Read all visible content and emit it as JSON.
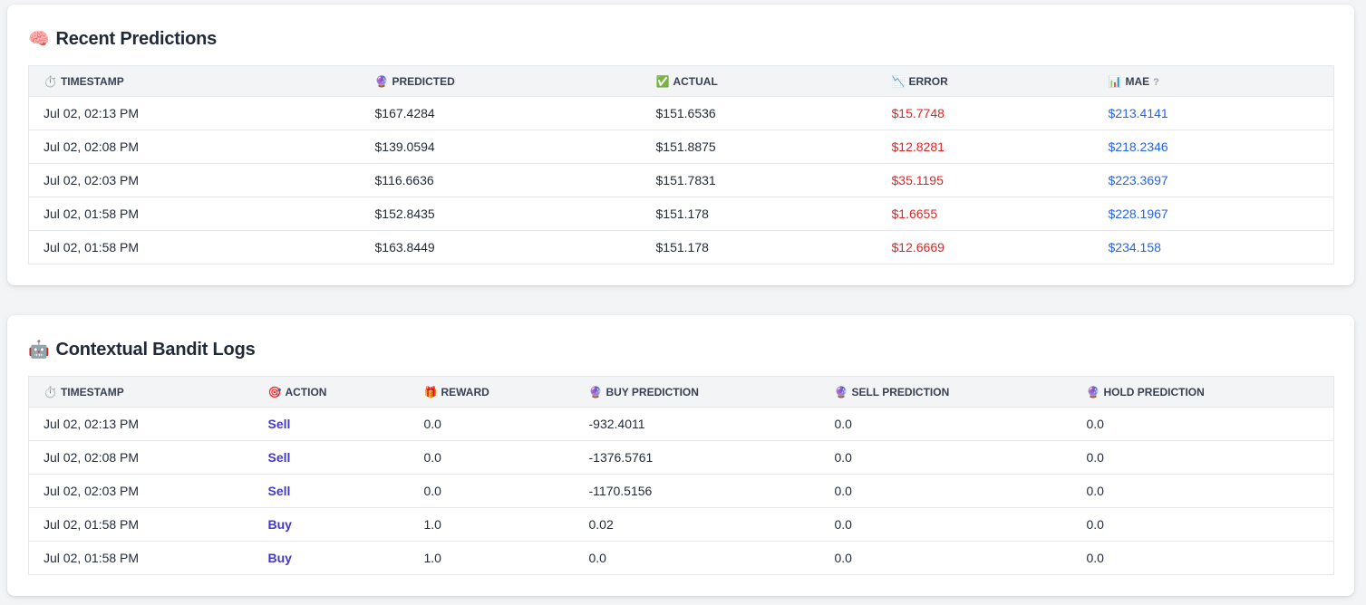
{
  "predictions": {
    "title": "Recent Predictions",
    "title_icon": "🧠",
    "headers": {
      "timestamp": {
        "icon": "⏱️",
        "label": "TIMESTAMP"
      },
      "predicted": {
        "icon": "🔮",
        "label": "PREDICTED"
      },
      "actual": {
        "icon": "✅",
        "label": "ACTUAL"
      },
      "error": {
        "icon": "📉",
        "label": "ERROR"
      },
      "mae": {
        "icon": "📊",
        "label": "MAE",
        "help": "?"
      }
    },
    "rows": [
      {
        "timestamp": "Jul 02, 02:13 PM",
        "predicted": "$167.4284",
        "actual": "$151.6536",
        "error": "$15.7748",
        "mae": "$213.4141"
      },
      {
        "timestamp": "Jul 02, 02:08 PM",
        "predicted": "$139.0594",
        "actual": "$151.8875",
        "error": "$12.8281",
        "mae": "$218.2346"
      },
      {
        "timestamp": "Jul 02, 02:03 PM",
        "predicted": "$116.6636",
        "actual": "$151.7831",
        "error": "$35.1195",
        "mae": "$223.3697"
      },
      {
        "timestamp": "Jul 02, 01:58 PM",
        "predicted": "$152.8435",
        "actual": "$151.178",
        "error": "$1.6655",
        "mae": "$228.1967"
      },
      {
        "timestamp": "Jul 02, 01:58 PM",
        "predicted": "$163.8449",
        "actual": "$151.178",
        "error": "$12.6669",
        "mae": "$234.158"
      }
    ]
  },
  "bandit": {
    "title": "Contextual Bandit Logs",
    "title_icon": "🤖",
    "headers": {
      "timestamp": {
        "icon": "⏱️",
        "label": "TIMESTAMP"
      },
      "action": {
        "icon": "🎯",
        "label": "ACTION"
      },
      "reward": {
        "icon": "🎁",
        "label": "REWARD"
      },
      "buy_prediction": {
        "icon": "🔮",
        "label": "BUY PREDICTION"
      },
      "sell_prediction": {
        "icon": "🔮",
        "label": "SELL PREDICTION"
      },
      "hold_prediction": {
        "icon": "🔮",
        "label": "HOLD PREDICTION"
      }
    },
    "rows": [
      {
        "timestamp": "Jul 02, 02:13 PM",
        "action": "Sell",
        "reward": "0.0",
        "buy": "-932.4011",
        "sell": "0.0",
        "hold": "0.0"
      },
      {
        "timestamp": "Jul 02, 02:08 PM",
        "action": "Sell",
        "reward": "0.0",
        "buy": "-1376.5761",
        "sell": "0.0",
        "hold": "0.0"
      },
      {
        "timestamp": "Jul 02, 02:03 PM",
        "action": "Sell",
        "reward": "0.0",
        "buy": "-1170.5156",
        "sell": "0.0",
        "hold": "0.0"
      },
      {
        "timestamp": "Jul 02, 01:58 PM",
        "action": "Buy",
        "reward": "1.0",
        "buy": "0.02",
        "sell": "0.0",
        "hold": "0.0"
      },
      {
        "timestamp": "Jul 02, 01:58 PM",
        "action": "Buy",
        "reward": "1.0",
        "buy": "0.0",
        "sell": "0.0",
        "hold": "0.0"
      }
    ]
  },
  "colors": {
    "error_text": "#dc2626",
    "mae_text": "#2563eb",
    "action_text": "#4338ca",
    "header_bg": "#f3f4f6",
    "page_bg": "#f3f4f6"
  }
}
